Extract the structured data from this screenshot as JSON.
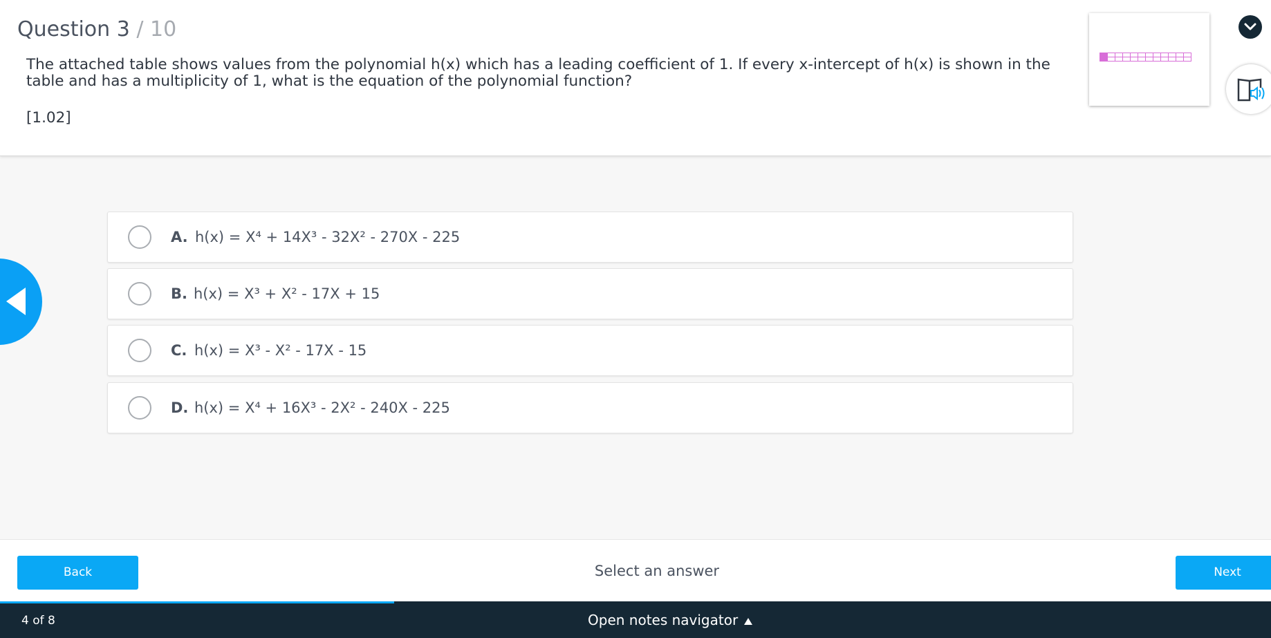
{
  "question": {
    "number": "Question 3",
    "total": " / 10",
    "text": "The attached table shows values from the polynomial h(x) which has a leading coefficient of 1. If every x-intercept of h(x) is shown in the table and has a multiplicity of 1, what is the equation of the polynomial function?",
    "code": "[1.02]"
  },
  "options": [
    {
      "letter": "A.",
      "text": "h(x) = X⁴ + 14X³ - 32X² - 270X - 225"
    },
    {
      "letter": "B.",
      "text": "h(x) = X³ + X² - 17X + 15"
    },
    {
      "letter": "C.",
      "text": "h(x) = X³ - X² - 17X - 15"
    },
    {
      "letter": "D.",
      "text": "h(x) = X⁴ + 16X³ - 2X² - 240X - 225"
    }
  ],
  "footer": {
    "back_label": "Back",
    "select_message": "Select an answer",
    "next_label": "Next"
  },
  "progress": {
    "fraction": 0.31
  },
  "navbar": {
    "page_count": "4 of 8",
    "notes_label": "Open notes navigator"
  },
  "colors": {
    "accent": "#0aa8f5",
    "navbar": "#152835",
    "table_thumb": "#d86ed8"
  },
  "icons": {
    "collapse": "chevron-down-icon",
    "audio": "book-audio-icon",
    "previous": "triangle-left-icon",
    "notes": "triangle-up-icon"
  }
}
